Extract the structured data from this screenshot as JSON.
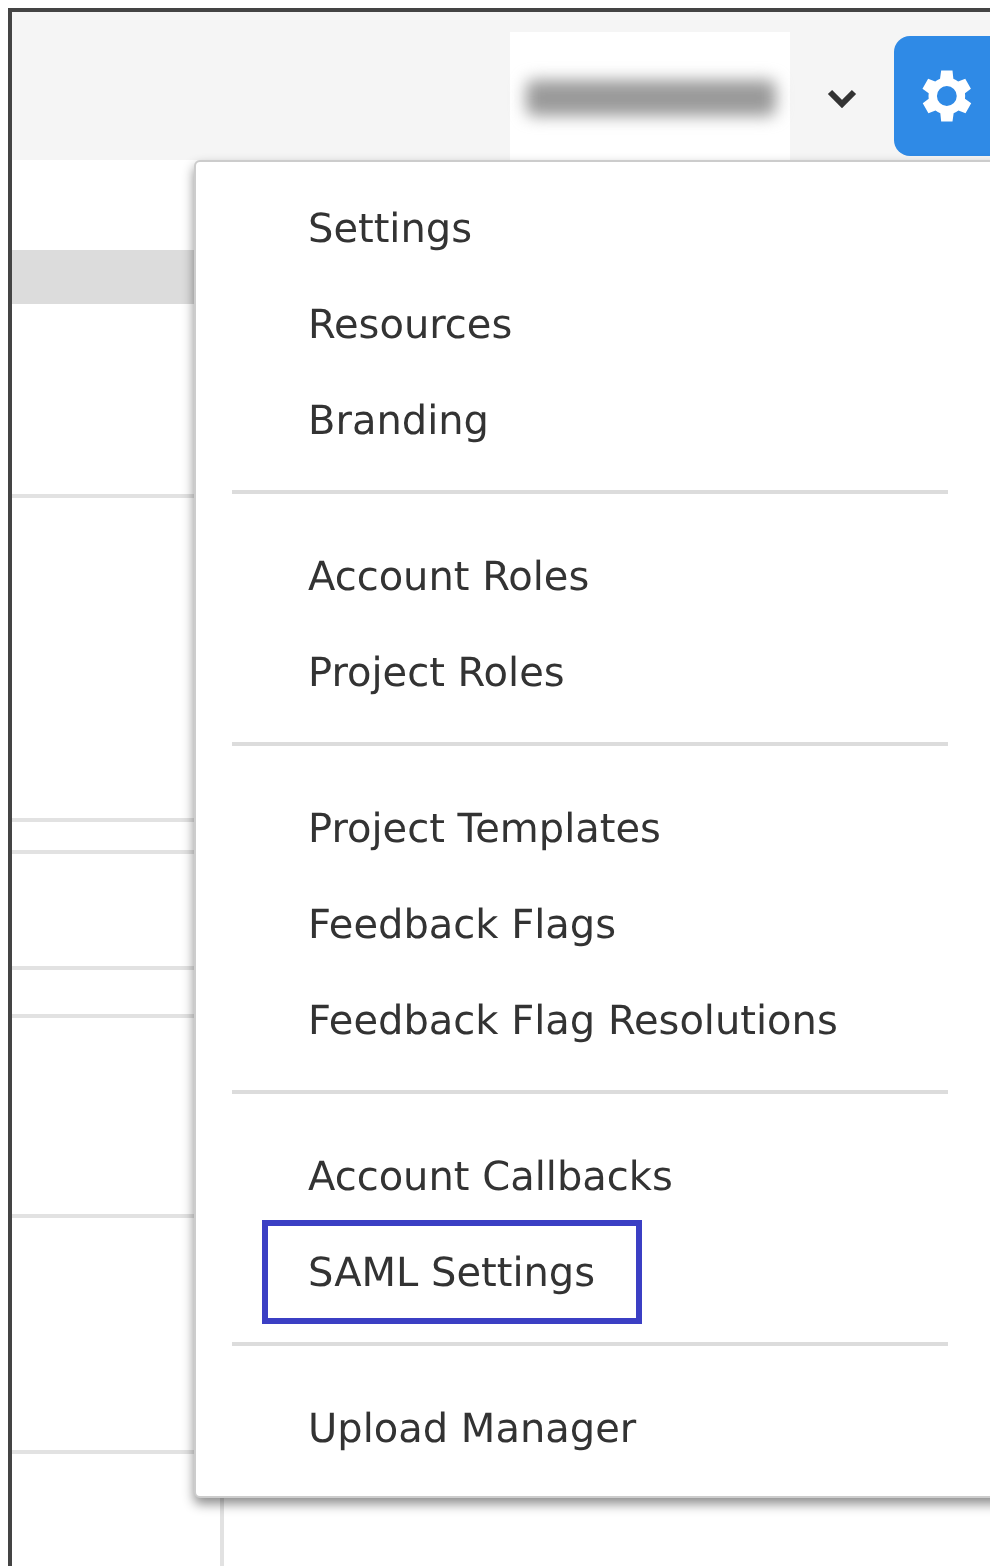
{
  "menu": {
    "groups": [
      {
        "items": [
          {
            "label": "Settings",
            "highlighted": false
          },
          {
            "label": "Resources",
            "highlighted": false
          },
          {
            "label": "Branding",
            "highlighted": false
          }
        ]
      },
      {
        "items": [
          {
            "label": "Account Roles",
            "highlighted": false
          },
          {
            "label": "Project Roles",
            "highlighted": false
          }
        ]
      },
      {
        "items": [
          {
            "label": "Project Templates",
            "highlighted": false
          },
          {
            "label": "Feedback Flags",
            "highlighted": false
          },
          {
            "label": "Feedback Flag Resolutions",
            "highlighted": false
          }
        ]
      },
      {
        "items": [
          {
            "label": "Account Callbacks",
            "highlighted": false
          },
          {
            "label": "SAML Settings",
            "highlighted": true
          }
        ]
      },
      {
        "items": [
          {
            "label": "Upload Manager",
            "highlighted": false
          }
        ]
      }
    ]
  }
}
